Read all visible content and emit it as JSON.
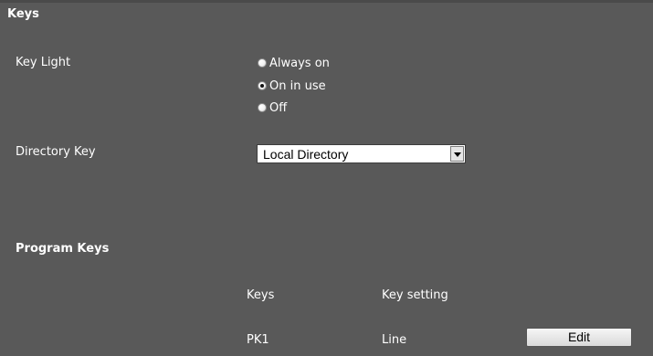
{
  "sections": {
    "keys_heading": "Keys",
    "program_keys_heading": "Program Keys"
  },
  "key_light": {
    "label": "Key Light",
    "options": [
      {
        "label": "Always on",
        "selected": false
      },
      {
        "label": "On in use",
        "selected": true
      },
      {
        "label": "Off",
        "selected": false
      }
    ]
  },
  "directory_key": {
    "label": "Directory Key",
    "selected_value": "Local Directory"
  },
  "program_keys": {
    "headers": {
      "keys": "Keys",
      "setting": "Key setting"
    },
    "rows": [
      {
        "key": "PK1",
        "setting": "Line",
        "action": "Edit"
      }
    ]
  },
  "icons": {
    "radio": "radio-button-icon",
    "dropdown": "chevron-down-icon"
  },
  "colors": {
    "background": "#595959",
    "text": "#ffffff"
  }
}
